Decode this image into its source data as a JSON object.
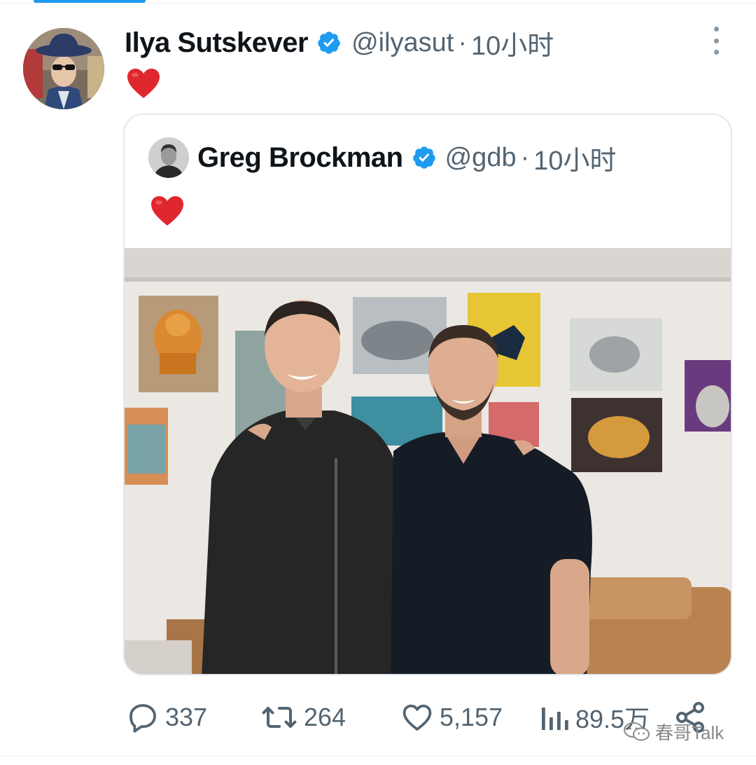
{
  "tweet": {
    "author_name": "Ilya Sutskever",
    "author_handle": "@ilyasut",
    "separator": "·",
    "time": "10小时",
    "text_emoji": "red-heart",
    "quoted": {
      "author_name": "Greg Brockman",
      "author_handle": "@gdb",
      "separator": "·",
      "time": "10小时",
      "text_emoji": "red-heart"
    },
    "metrics": {
      "replies": "337",
      "reposts": "264",
      "likes": "5,157",
      "views": "89.5万"
    }
  },
  "watermark": "春哥Talk",
  "colors": {
    "verified_badge": "#1d9bf0",
    "heart": "#e0245e",
    "secondary_text": "#536471",
    "tab_accent": "#1d9bf0"
  },
  "icons": [
    "verified-badge-icon",
    "more-icon",
    "reply-icon",
    "repost-icon",
    "like-icon",
    "views-icon",
    "share-icon",
    "wechat-icon"
  ]
}
